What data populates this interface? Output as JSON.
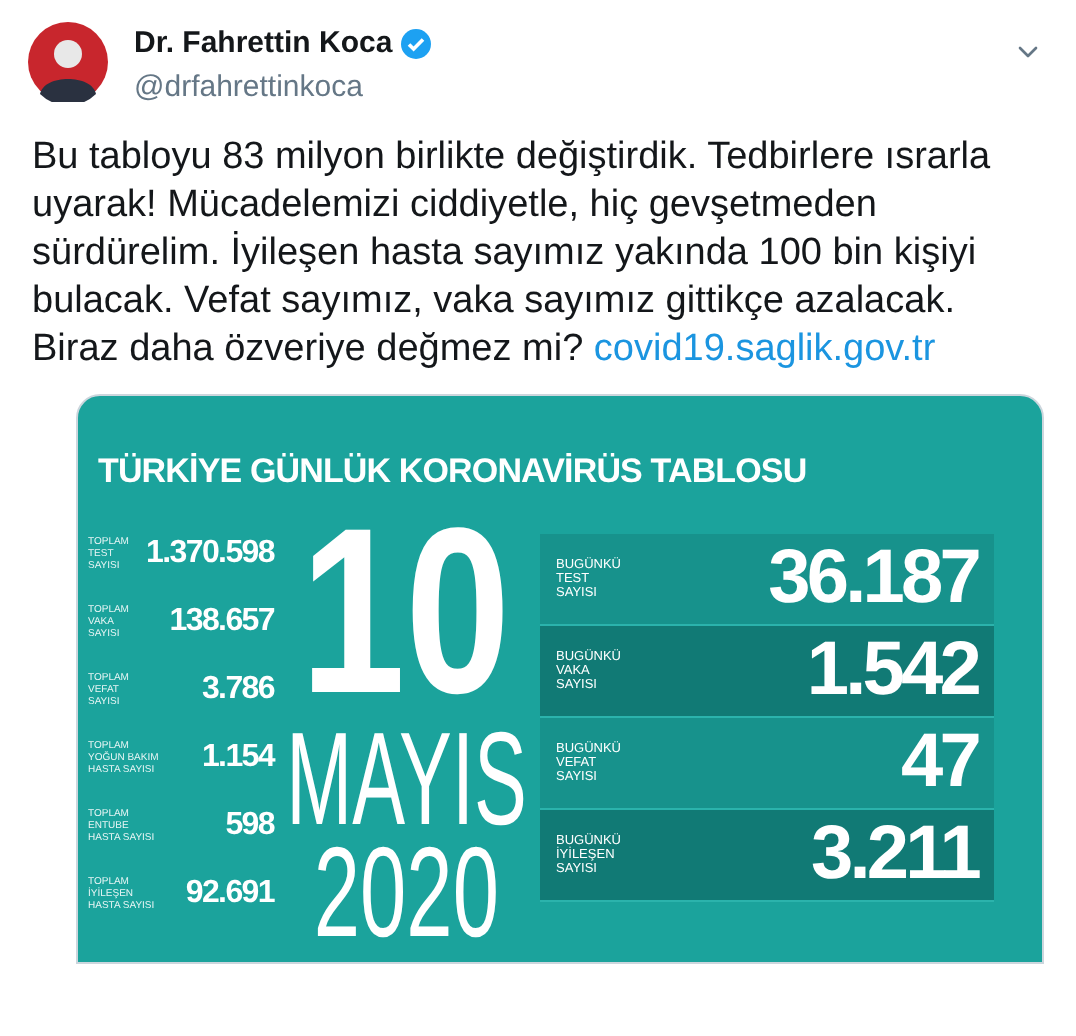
{
  "tweet": {
    "author": {
      "name": "Dr. Fahrettin Koca",
      "handle": "@drfahrettinkoca",
      "verified": true
    },
    "text": "Bu tabloyu 83 milyon birlikte değiştirdik. Tedbirlere ısrarla uyarak! Mücadelemizi ciddiyetle, hiç gevşetmeden sürdürelim. İyileşen hasta sayımız yakında 100 bin kişiyi bulacak. Vefat sayımız, vaka sayımız gittikçe azalacak. Biraz daha özveriye değmez mi?",
    "link": "covid19.saglik.gov.tr"
  },
  "infographic": {
    "title": "TÜRKİYE GÜNLÜK KORONAVİRÜS TABLOSU",
    "totals": [
      {
        "label_lines": [
          "TOPLAM",
          "TEST",
          "SAYISI"
        ],
        "value": "1.370.598"
      },
      {
        "label_lines": [
          "TOPLAM",
          "VAKA",
          "SAYISI"
        ],
        "value": "138.657"
      },
      {
        "label_lines": [
          "TOPLAM",
          "VEFAT",
          "SAYISI"
        ],
        "value": "3.786"
      },
      {
        "label_lines": [
          "TOPLAM",
          "YOĞUN BAKIM",
          "HASTA SAYISI"
        ],
        "value": "1.154"
      },
      {
        "label_lines": [
          "TOPLAM",
          "ENTUBE",
          "HASTA SAYISI"
        ],
        "value": "598"
      },
      {
        "label_lines": [
          "TOPLAM",
          "İYİLEŞEN",
          "HASTA SAYISI"
        ],
        "value": "92.691"
      }
    ],
    "date": {
      "day": "10",
      "month": "MAYIS",
      "year": "2020"
    },
    "today": [
      {
        "label_lines": [
          "BUGÜNKÜ",
          "TEST",
          "SAYISI"
        ],
        "value": "36.187"
      },
      {
        "label_lines": [
          "BUGÜNKÜ",
          "VAKA",
          "SAYISI"
        ],
        "value": "1.542"
      },
      {
        "label_lines": [
          "BUGÜNKÜ",
          "VEFAT",
          "SAYISI"
        ],
        "value": "47"
      },
      {
        "label_lines": [
          "BUGÜNKÜ",
          "İYİLEŞEN",
          "SAYISI"
        ],
        "value": "3.211"
      }
    ]
  }
}
